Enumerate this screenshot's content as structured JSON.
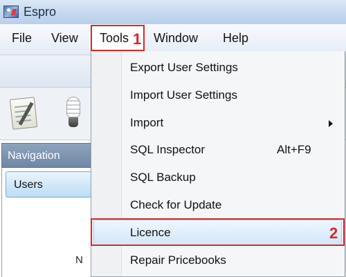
{
  "window": {
    "title": "Espro",
    "app_icon": "espro-app-icon"
  },
  "menubar": {
    "file": "File",
    "view": "View",
    "tools": "Tools",
    "window": "Window",
    "help": "Help"
  },
  "annotations": {
    "step1": "1",
    "step2": "2",
    "highlight_color": "#d82828"
  },
  "toolbar": {
    "icons": [
      "notepad-icon",
      "lightbulb-icon"
    ]
  },
  "navigation": {
    "header": "Navigation",
    "items": [
      "Users"
    ],
    "partial_text": "N"
  },
  "tools_menu": {
    "items": [
      {
        "label": "Export User Settings"
      },
      {
        "label": "Import User Settings"
      },
      {
        "label": "Import",
        "has_submenu": true
      },
      {
        "label": "SQL Inspector",
        "shortcut": "Alt+F9"
      },
      {
        "label": "SQL Backup"
      },
      {
        "label": "Check for Update"
      },
      {
        "label": "Licence",
        "highlighted": true
      },
      {
        "label": "Repair Pricebooks"
      }
    ]
  }
}
